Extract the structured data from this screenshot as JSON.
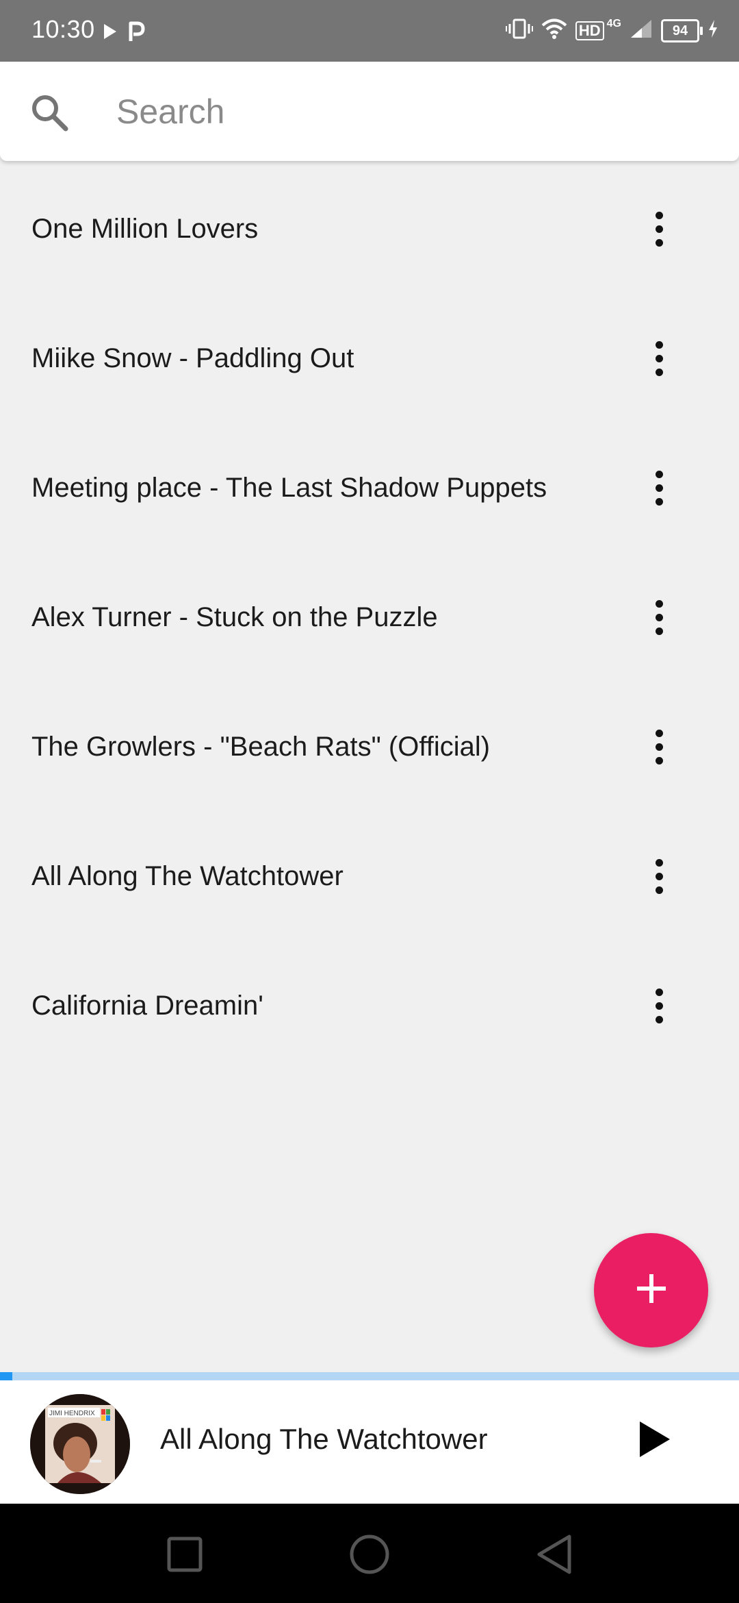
{
  "status_bar": {
    "time": "10:30",
    "network_label": "HD",
    "network_type": "4G",
    "battery_level": "94",
    "icons": [
      "play-indicator-icon",
      "parking-app-icon",
      "vibrate-icon",
      "wifi-icon",
      "signal-icon",
      "charging-icon"
    ]
  },
  "search": {
    "placeholder": "Search",
    "value": ""
  },
  "songs": [
    {
      "title": "One Million Lovers"
    },
    {
      "title": "Miike Snow - Paddling Out"
    },
    {
      "title": "Meeting place - The Last Shadow Puppets"
    },
    {
      "title": "Alex Turner - Stuck on the Puzzle"
    },
    {
      "title": "The Growlers - \"Beach Rats\" (Official)"
    },
    {
      "title": "All Along The Watchtower"
    },
    {
      "title": "California Dreamin'"
    }
  ],
  "fab": {
    "icon": "plus-icon",
    "color": "#e91e63"
  },
  "player": {
    "now_playing_title": "All Along The Watchtower",
    "progress_fraction": 0.017,
    "album_art_text": "JIMI HENDRIX",
    "progress_color": "#2196f3",
    "progress_track_color": "#b3d6f5"
  },
  "nav_bar": {
    "buttons": [
      "recents-icon",
      "home-icon",
      "back-icon"
    ]
  }
}
